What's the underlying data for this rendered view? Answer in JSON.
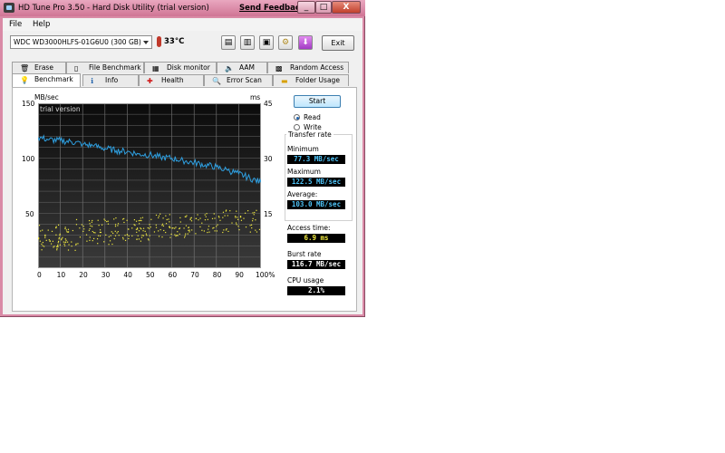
{
  "window": {
    "title": "HD Tune Pro 3.50 - Hard Disk Utility (trial version)",
    "feedback_link": "Send Feedback",
    "controls": [
      "_",
      "□",
      "X"
    ]
  },
  "menu": [
    "File",
    "Help"
  ],
  "toolbar": {
    "drive": "WDC WD3000HLFS-01G6U0 (300 GB)",
    "temperature": "33°C",
    "exit_label": "Exit"
  },
  "tabs_top": [
    {
      "label": "Erase",
      "icon": "trash-icon"
    },
    {
      "label": "File Benchmark",
      "icon": "file-icon"
    },
    {
      "label": "Disk monitor",
      "icon": "monitor-icon"
    },
    {
      "label": "AAM",
      "icon": "speaker-icon"
    },
    {
      "label": "Random Access",
      "icon": "grid-icon"
    }
  ],
  "tabs_bottom": [
    {
      "label": "Benchmark",
      "icon": "benchmark-icon",
      "active": true
    },
    {
      "label": "Info",
      "icon": "info-icon"
    },
    {
      "label": "Health",
      "icon": "health-icon"
    },
    {
      "label": "Error Scan",
      "icon": "magnifier-icon"
    },
    {
      "label": "Folder Usage",
      "icon": "folder-icon"
    }
  ],
  "benchmark": {
    "start_label": "Start",
    "read_label": "Read",
    "write_label": "Write",
    "transfer_rate_label": "Transfer rate",
    "minimum_label": "Minimum",
    "minimum_value": "77.3 MB/sec",
    "maximum_label": "Maximum",
    "maximum_value": "122.5 MB/sec",
    "average_label": "Average:",
    "average_value": "103.0 MB/sec",
    "access_time_label": "Access time:",
    "access_time_value": "6.9 ms",
    "burst_rate_label": "Burst rate",
    "burst_rate_value": "116.7 MB/sec",
    "cpu_usage_label": "CPU usage",
    "cpu_usage_value": "2.1%"
  },
  "chart_data": {
    "type": "line",
    "watermark": "trial version",
    "ylabel_left": "MB/sec",
    "ylabel_right": "ms",
    "ylim_left": [
      0,
      150
    ],
    "ylim_right": [
      0,
      45
    ],
    "yticks_left": [
      "150",
      "100",
      "50"
    ],
    "yticks_right": [
      "45",
      "30",
      "15"
    ],
    "xticks": [
      "0",
      "10",
      "20",
      "30",
      "40",
      "50",
      "60",
      "70",
      "80",
      "90",
      "100%"
    ],
    "grid": true,
    "series": [
      {
        "x": [
          0,
          5,
          10,
          15,
          20,
          25,
          30,
          35,
          40,
          45,
          50,
          55,
          60,
          65,
          70,
          75,
          80,
          85,
          90,
          95,
          100
        ],
        "values": [
          119,
          117,
          116,
          115,
          113,
          111,
          109,
          107,
          106,
          104,
          103,
          101,
          100,
          98,
          96,
          94,
          92,
          89,
          86,
          82,
          78
        ],
        "color": "#2e9fe0"
      }
    ],
    "access_scatter": {
      "color": "#f0e940",
      "x_range": [
        0,
        100
      ],
      "ms_min": [
        5,
        6.5,
        7.5,
        8.5,
        9.5,
        10
      ],
      "ms_max": [
        12,
        13.5,
        14,
        15,
        15.5,
        16
      ]
    }
  }
}
